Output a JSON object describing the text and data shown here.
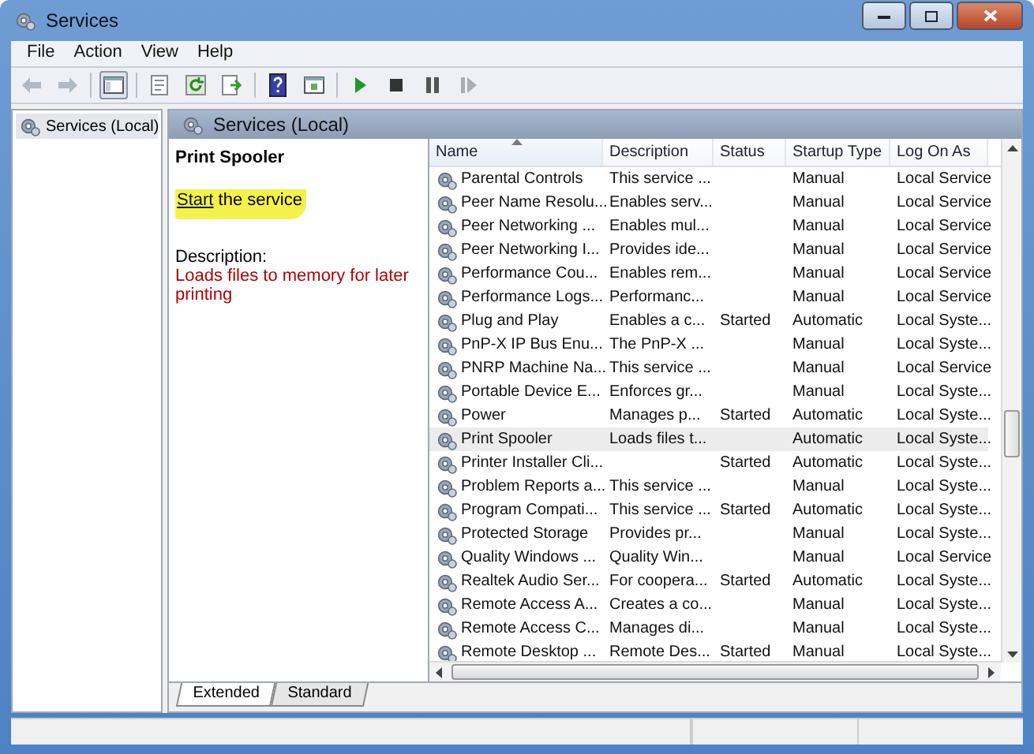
{
  "window": {
    "title": "Services"
  },
  "menu": [
    "File",
    "Action",
    "View",
    "Help"
  ],
  "toolbar": [
    {
      "kind": "back",
      "disabled": true,
      "pressed": false
    },
    {
      "kind": "forward",
      "disabled": true,
      "pressed": false
    },
    {
      "kind": "tree",
      "disabled": false,
      "pressed": true
    },
    {
      "kind": "properties",
      "disabled": false,
      "pressed": false
    },
    {
      "kind": "refresh",
      "disabled": false,
      "pressed": false
    },
    {
      "kind": "export",
      "disabled": false,
      "pressed": false
    },
    {
      "kind": "help",
      "disabled": false,
      "pressed": false
    },
    {
      "kind": "console",
      "disabled": false,
      "pressed": false
    },
    {
      "kind": "start",
      "disabled": false,
      "pressed": false
    },
    {
      "kind": "stop",
      "disabled": false,
      "pressed": false
    },
    {
      "kind": "pause",
      "disabled": false,
      "pressed": false
    },
    {
      "kind": "restart",
      "disabled": true,
      "pressed": false
    }
  ],
  "tree": {
    "items": [
      {
        "label": "Services (Local)",
        "selected": true
      }
    ]
  },
  "panel": {
    "title": "Services (Local)",
    "service_name": "Print Spooler",
    "action": {
      "link": "Start",
      "text": " the service",
      "highlighted": true
    },
    "description_label": "Description:",
    "description": "Loads files to memory for later printing"
  },
  "table": {
    "columns": [
      {
        "label": "Name",
        "sorted": true
      },
      {
        "label": "Description",
        "sorted": false
      },
      {
        "label": "Status",
        "sorted": false
      },
      {
        "label": "Startup Type",
        "sorted": false
      },
      {
        "label": "Log On As",
        "sorted": false
      }
    ],
    "rows": [
      {
        "cells": [
          "Parental Controls",
          "This service ...",
          "",
          "Manual",
          "Local Service"
        ],
        "selected": false
      },
      {
        "cells": [
          "Peer Name Resolu...",
          "Enables serv...",
          "",
          "Manual",
          "Local Service"
        ],
        "selected": false
      },
      {
        "cells": [
          "Peer Networking ...",
          "Enables mul...",
          "",
          "Manual",
          "Local Service"
        ],
        "selected": false
      },
      {
        "cells": [
          "Peer Networking I...",
          "Provides ide...",
          "",
          "Manual",
          "Local Service"
        ],
        "selected": false
      },
      {
        "cells": [
          "Performance Cou...",
          "Enables rem...",
          "",
          "Manual",
          "Local Service"
        ],
        "selected": false
      },
      {
        "cells": [
          "Performance Logs...",
          "Performanc...",
          "",
          "Manual",
          "Local Service"
        ],
        "selected": false
      },
      {
        "cells": [
          "Plug and Play",
          "Enables a c...",
          "Started",
          "Automatic",
          "Local Syste..."
        ],
        "selected": false
      },
      {
        "cells": [
          "PnP-X IP Bus Enu...",
          "The PnP-X ...",
          "",
          "Manual",
          "Local Syste..."
        ],
        "selected": false
      },
      {
        "cells": [
          "PNRP Machine Na...",
          "This service ...",
          "",
          "Manual",
          "Local Service"
        ],
        "selected": false
      },
      {
        "cells": [
          "Portable Device E...",
          "Enforces gr...",
          "",
          "Manual",
          "Local Syste..."
        ],
        "selected": false
      },
      {
        "cells": [
          "Power",
          "Manages p...",
          "Started",
          "Automatic",
          "Local Syste..."
        ],
        "selected": false
      },
      {
        "cells": [
          "Print Spooler",
          "Loads files t...",
          "",
          "Automatic",
          "Local Syste..."
        ],
        "selected": true
      },
      {
        "cells": [
          "Printer Installer Cli...",
          "",
          "Started",
          "Automatic",
          "Local Syste..."
        ],
        "selected": false
      },
      {
        "cells": [
          "Problem Reports a...",
          "This service ...",
          "",
          "Manual",
          "Local Syste..."
        ],
        "selected": false
      },
      {
        "cells": [
          "Program Compati...",
          "This service ...",
          "Started",
          "Automatic",
          "Local Syste..."
        ],
        "selected": false
      },
      {
        "cells": [
          "Protected Storage",
          "Provides pr...",
          "",
          "Manual",
          "Local Syste..."
        ],
        "selected": false
      },
      {
        "cells": [
          "Quality Windows ...",
          "Quality Win...",
          "",
          "Manual",
          "Local Service"
        ],
        "selected": false
      },
      {
        "cells": [
          "Realtek Audio Ser...",
          "For coopera...",
          "Started",
          "Automatic",
          "Local Syste..."
        ],
        "selected": false
      },
      {
        "cells": [
          "Remote Access A...",
          "Creates a co...",
          "",
          "Manual",
          "Local Syste..."
        ],
        "selected": false
      },
      {
        "cells": [
          "Remote Access C...",
          "Manages di...",
          "",
          "Manual",
          "Local Syste..."
        ],
        "selected": false
      },
      {
        "cells": [
          "Remote Desktop ...",
          "Remote Des...",
          "Started",
          "Manual",
          "Local Syste..."
        ],
        "selected": false
      }
    ]
  },
  "tabs": [
    {
      "label": "Extended",
      "selected": true
    },
    {
      "label": "Standard",
      "selected": false
    }
  ]
}
